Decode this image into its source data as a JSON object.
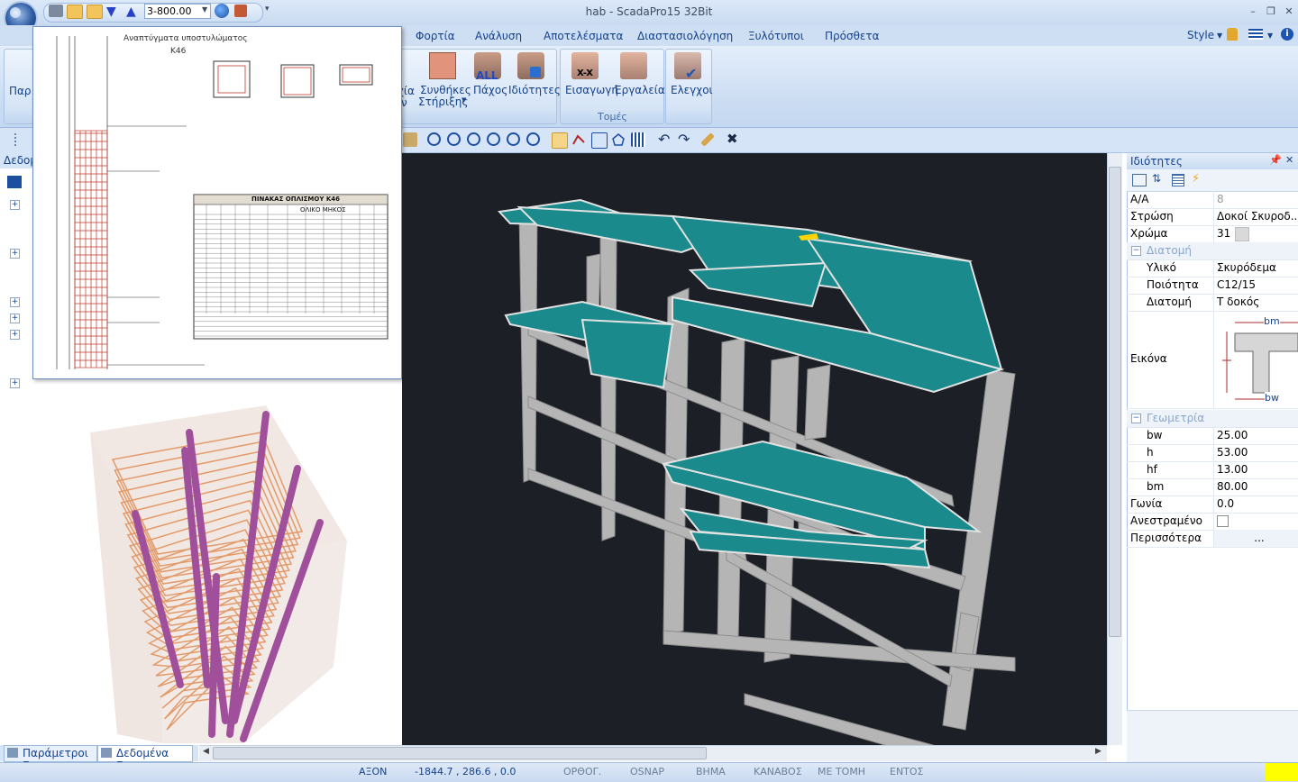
{
  "window": {
    "title": "hab - ScadaPro15 32Bit"
  },
  "qat": {
    "level_value": "3-800.00"
  },
  "tabs": [
    "Φορτία",
    "Ανάλυση",
    "Αποτελέσματα",
    "Διαστασιολόγηση",
    "Ξυλότυποι",
    "Πρόσθετα"
  ],
  "ribbon": {
    "style_label": "Style",
    "partial_left_label": "Παρ",
    "partial_left_label2": "χία",
    "partial_left_label3": "ν",
    "supports_label_1": "Συνθήκες",
    "supports_label_2": "Στήριξης",
    "thickness_label": "Πάχος",
    "thickness_icon_text": "ALL",
    "properties_label": "Ιδιότητες",
    "insert_label": "Εισαγωγή",
    "insert_icon_text": "X-X",
    "tools_label": "Εργαλεία",
    "group_sections": "Τομές",
    "checks_label": "Ελεγχοι"
  },
  "left": {
    "header": "Δεδομ",
    "drawing": {
      "title": "Αναπτύγματα υποστυλώματος",
      "subtitle": "Κ46",
      "table_title": "ΠΙΝΑΚΑΣ ΟΠΛΙΣΜΟΥ Κ46",
      "table_sub": "ΟΛΙΚΟ ΜΗΚΟΣ"
    }
  },
  "bottom_tabs": [
    "Παράμετροι Ε...",
    "Δεδομένα Εργ..."
  ],
  "properties": {
    "header": "Ιδιότητες",
    "rows": [
      {
        "name": "Α/Α",
        "value": "8",
        "muted": true
      },
      {
        "name": "Στρώση",
        "value": "Δοκοί Σκυροδ..."
      },
      {
        "name": "Χρώμα",
        "value": "31"
      }
    ],
    "cat_section": "Διατομή",
    "section_rows": [
      {
        "name": "Υλικό",
        "value": "Σκυρόδεμα"
      },
      {
        "name": "Ποιότητα",
        "value": "C12/15"
      },
      {
        "name": "Διατομή",
        "value": "T δοκός"
      }
    ],
    "image_label": "Εικόνα",
    "img_bm": "bm",
    "img_bw": "bw",
    "cat_geometry": "Γεωμετρία",
    "geometry_rows": [
      {
        "name": "bw",
        "value": "25.00"
      },
      {
        "name": "h",
        "value": "53.00"
      },
      {
        "name": "hf",
        "value": "13.00"
      },
      {
        "name": "bm",
        "value": "80.00"
      }
    ],
    "tail_rows": [
      {
        "name": "Γωνία",
        "value": "0.0"
      },
      {
        "name": "Ανεστραμένο",
        "value": ""
      },
      {
        "name": "Περισσότερα",
        "value": "..."
      }
    ]
  },
  "status": {
    "axis": "ΑΞΟΝ",
    "coords": "-1844.7 , 286.6 , 0.0",
    "ortho": "ΟΡΘΟΓ.",
    "osnap": "OSNAP",
    "step": "ΒΗΜΑ",
    "grid": "ΚΑΝΑΒΟΣ",
    "section": "ΜΕ ΤΟΜΗ",
    "inside": "ΕΝΤΟΣ"
  },
  "colors": {
    "slab": "#1a8a8c",
    "frame": "#b9b9b9",
    "viewport_bg": "#1c1f25",
    "rebar": "#a0509b",
    "stirrup": "#e39a6a"
  }
}
